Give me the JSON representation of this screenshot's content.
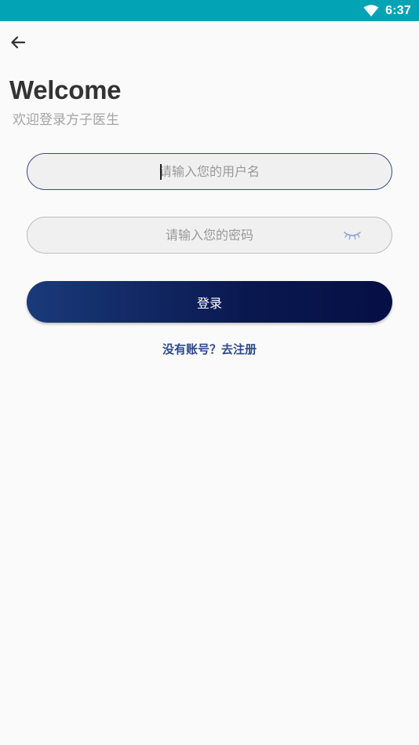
{
  "status_bar": {
    "time": "6:37",
    "background_color": "#03a3b6",
    "icons": [
      "wifi-icon"
    ]
  },
  "header": {
    "back_icon": "arrow-left-icon",
    "title": "Welcome",
    "subtitle": "欢迎登录方子医生"
  },
  "form": {
    "username": {
      "value": "",
      "placeholder": "请输入您的用户名"
    },
    "password": {
      "value": "",
      "placeholder": "请输入您的密码",
      "toggle_icon": "eye-closed-icon"
    },
    "login_label": "登录",
    "register_link": "没有账号？去注册"
  },
  "colors": {
    "accent": "#2e4a8a",
    "button_gradient_start": "#1a3a7a",
    "button_gradient_end": "#050f45",
    "focused_border": "#3d4a82",
    "eye_icon": "#8fa3d6"
  }
}
